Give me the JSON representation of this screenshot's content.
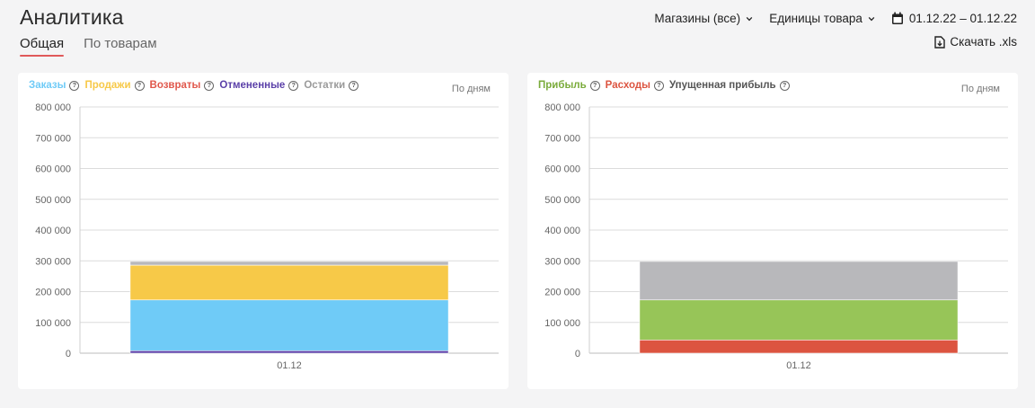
{
  "page": {
    "title": "Аналитика"
  },
  "tabs": [
    {
      "label": "Общая",
      "active": true
    },
    {
      "label": "По товарам",
      "active": false
    }
  ],
  "filters": {
    "stores": "Магазины (все)",
    "units": "Единицы товара",
    "date_range": "01.12.22 – 01.12.22"
  },
  "download": {
    "label": "Скачать .xls"
  },
  "colors": {
    "accent": "#e0595a",
    "orders": "#6fcbf7",
    "sales": "#f7c948",
    "returns": "#e0574b",
    "cancelled": "#5a3fa8",
    "stock": "#b8b8bb",
    "profit": "#97c558",
    "expenses": "#dc5440",
    "lost_profit": "#b8b8bb"
  },
  "chart_data": [
    {
      "type": "bar",
      "stacked": true,
      "period_label": "По дням",
      "categories": [
        "01.12"
      ],
      "ylim": [
        0,
        800000
      ],
      "yticks": [
        "800 000",
        "700 000",
        "600 000",
        "500 000",
        "400 000",
        "300 000",
        "200 000",
        "100 000",
        "0"
      ],
      "legend": [
        {
          "name": "Заказы",
          "color": "#6fcbf7"
        },
        {
          "name": "Продажи",
          "color": "#f7c948"
        },
        {
          "name": "Возвраты",
          "color": "#e0574b"
        },
        {
          "name": "Отмененные",
          "color": "#5a3fa8"
        },
        {
          "name": "Остатки",
          "color": "#9a9a9a"
        }
      ],
      "series": [
        {
          "name": "Отмененные",
          "values": [
            8000
          ],
          "color": "#5a3fa8"
        },
        {
          "name": "Заказы",
          "values": [
            165000
          ],
          "color": "#6fcbf7"
        },
        {
          "name": "Продажи",
          "values": [
            113000
          ],
          "color": "#f7c948"
        },
        {
          "name": "Остатки",
          "values": [
            12000
          ],
          "color": "#b8b8bb"
        }
      ]
    },
    {
      "type": "bar",
      "stacked": true,
      "period_label": "По дням",
      "categories": [
        "01.12"
      ],
      "ylim": [
        0,
        800000
      ],
      "yticks": [
        "800 000",
        "700 000",
        "600 000",
        "500 000",
        "400 000",
        "300 000",
        "200 000",
        "100 000",
        "0"
      ],
      "legend": [
        {
          "name": "Прибыль",
          "color": "#7aab3a"
        },
        {
          "name": "Расходы",
          "color": "#dc5440"
        },
        {
          "name": "Упущенная прибыль",
          "color": "#555555"
        }
      ],
      "series": [
        {
          "name": "Расходы",
          "values": [
            43000
          ],
          "color": "#dc5440"
        },
        {
          "name": "Прибыль",
          "values": [
            130000
          ],
          "color": "#97c558"
        },
        {
          "name": "Упущенная прибыль",
          "values": [
            125000
          ],
          "color": "#b8b8bb"
        }
      ]
    }
  ]
}
